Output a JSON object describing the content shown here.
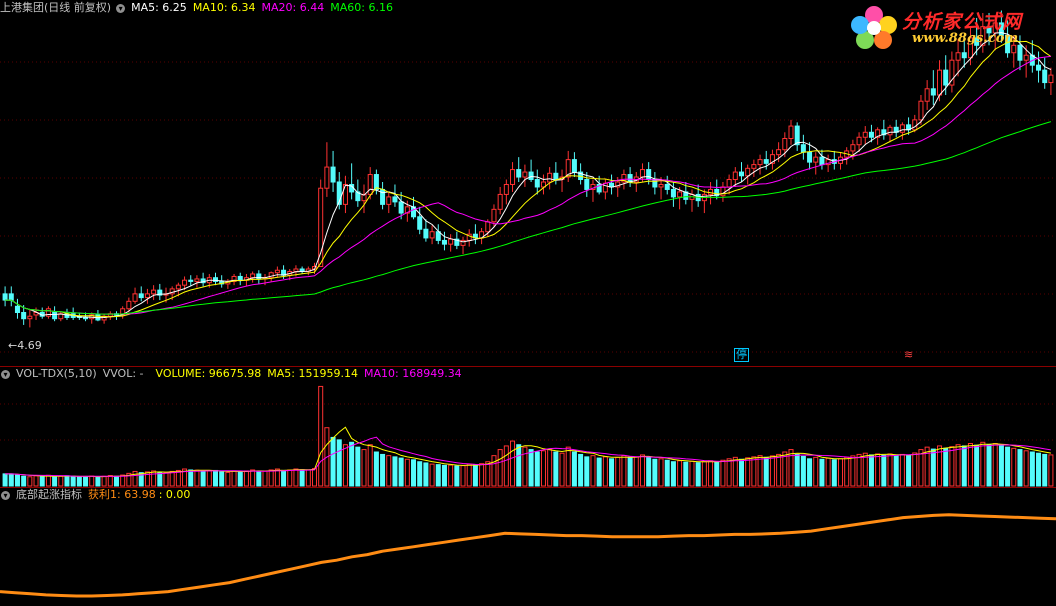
{
  "colors": {
    "up": "#ff3232",
    "down": "#54fcfc",
    "ma5": "#ffffff",
    "ma10": "#ffff00",
    "ma20": "#ff00ff",
    "ma60": "#00ff00",
    "profit": "#ff8c14",
    "sep": "#8b0000"
  },
  "main_header": {
    "stock_title": "上港集团(日线 前复权)",
    "ma5": "MA5: 6.25",
    "ma10": "MA10: 6.34",
    "ma20": "MA20: 6.44",
    "ma60": "MA60: 6.16"
  },
  "low_label": "4.69",
  "event_marks": {
    "halt": "停",
    "other": "≋"
  },
  "logo": {
    "title": "分析家公式网",
    "url": "www.88gs.com",
    "icon": "flower-logo-icon"
  },
  "vol_header": {
    "name": "VOL-TDX(5,10)",
    "vvol": "VVOL: -",
    "volume": "VOLUME: 96675.98",
    "ma5": "MA5: 151959.14",
    "ma10": "MA10: 168949.34"
  },
  "ind_header": {
    "name": "底部起涨指标",
    "profit": "获利1: 63.98",
    "extra": ": 0.00"
  },
  "chart_data": {
    "type": "candlestick",
    "price_ylim": [
      4.4,
      7.2
    ],
    "ohlc": [
      [
        4.9,
        4.96,
        4.8,
        4.85
      ],
      [
        4.9,
        4.96,
        4.8,
        4.85
      ],
      [
        4.8,
        4.86,
        4.7,
        4.75
      ],
      [
        4.75,
        4.81,
        4.65,
        4.7
      ],
      [
        4.7,
        4.77,
        4.63,
        4.72
      ],
      [
        4.73,
        4.79,
        4.69,
        4.75
      ],
      [
        4.75,
        4.79,
        4.7,
        4.72
      ],
      [
        4.72,
        4.8,
        4.7,
        4.78
      ],
      [
        4.75,
        4.8,
        4.68,
        4.7
      ],
      [
        4.7,
        4.76,
        4.68,
        4.74
      ],
      [
        4.74,
        4.78,
        4.69,
        4.71
      ],
      [
        4.74,
        4.79,
        4.69,
        4.71
      ],
      [
        4.72,
        4.75,
        4.69,
        4.71
      ],
      [
        4.71,
        4.75,
        4.68,
        4.7
      ],
      [
        4.7,
        4.75,
        4.66,
        4.73
      ],
      [
        4.73,
        4.77,
        4.68,
        4.69
      ],
      [
        4.69,
        4.74,
        4.66,
        4.72
      ],
      [
        4.72,
        4.76,
        4.69,
        4.74
      ],
      [
        4.74,
        4.76,
        4.69,
        4.73
      ],
      [
        4.73,
        4.8,
        4.7,
        4.78
      ],
      [
        4.78,
        4.87,
        4.75,
        4.84
      ],
      [
        4.84,
        4.95,
        4.82,
        4.9
      ],
      [
        4.9,
        4.96,
        4.84,
        4.87
      ],
      [
        4.87,
        4.94,
        4.82,
        4.9
      ],
      [
        4.9,
        4.97,
        4.85,
        4.93
      ],
      [
        4.93,
        4.98,
        4.85,
        4.89
      ],
      [
        4.89,
        4.95,
        4.83,
        4.9
      ],
      [
        4.9,
        4.96,
        4.85,
        4.94
      ],
      [
        4.94,
        4.99,
        4.88,
        4.97
      ],
      [
        4.97,
        5.04,
        4.93,
        5.01
      ],
      [
        5.01,
        5.05,
        4.96,
        5.0
      ],
      [
        5.0,
        5.05,
        4.95,
        5.02
      ],
      [
        5.02,
        5.07,
        4.96,
        4.99
      ],
      [
        4.99,
        5.06,
        4.95,
        5.03
      ],
      [
        5.03,
        5.07,
        4.97,
        5.0
      ],
      [
        5.0,
        5.05,
        4.95,
        4.98
      ],
      [
        4.98,
        5.02,
        4.94,
        5.0
      ],
      [
        5.0,
        5.06,
        4.97,
        5.04
      ],
      [
        5.04,
        5.07,
        4.97,
        5.01
      ],
      [
        5.01,
        5.06,
        4.96,
        5.03
      ],
      [
        5.03,
        5.08,
        4.99,
        5.06
      ],
      [
        5.06,
        5.09,
        4.98,
        5.02
      ],
      [
        5.02,
        5.06,
        4.97,
        5.03
      ],
      [
        5.03,
        5.08,
        5.0,
        5.07
      ],
      [
        5.07,
        5.12,
        5.03,
        5.09
      ],
      [
        5.09,
        5.13,
        5.02,
        5.05
      ],
      [
        5.05,
        5.1,
        5.01,
        5.08
      ],
      [
        5.08,
        5.13,
        5.04,
        5.1
      ],
      [
        5.1,
        5.12,
        5.06,
        5.08
      ],
      [
        5.08,
        5.12,
        5.05,
        5.1
      ],
      [
        5.1,
        5.15,
        5.06,
        5.12
      ],
      [
        5.12,
        5.82,
        5.12,
        5.75
      ],
      [
        5.75,
        6.12,
        5.68,
        5.92
      ],
      [
        5.92,
        6.05,
        5.72,
        5.8
      ],
      [
        5.8,
        5.88,
        5.58,
        5.62
      ],
      [
        5.62,
        5.85,
        5.55,
        5.78
      ],
      [
        5.78,
        5.95,
        5.66,
        5.72
      ],
      [
        5.72,
        5.82,
        5.6,
        5.65
      ],
      [
        5.65,
        5.78,
        5.55,
        5.7
      ],
      [
        5.7,
        5.92,
        5.66,
        5.86
      ],
      [
        5.86,
        5.9,
        5.7,
        5.74
      ],
      [
        5.74,
        5.8,
        5.58,
        5.62
      ],
      [
        5.62,
        5.72,
        5.55,
        5.68
      ],
      [
        5.68,
        5.78,
        5.6,
        5.64
      ],
      [
        5.64,
        5.72,
        5.5,
        5.55
      ],
      [
        5.55,
        5.65,
        5.48,
        5.6
      ],
      [
        5.6,
        5.68,
        5.5,
        5.52
      ],
      [
        5.52,
        5.6,
        5.38,
        5.42
      ],
      [
        5.42,
        5.5,
        5.32,
        5.35
      ],
      [
        5.35,
        5.45,
        5.3,
        5.4
      ],
      [
        5.4,
        5.46,
        5.3,
        5.33
      ],
      [
        5.33,
        5.4,
        5.25,
        5.3
      ],
      [
        5.3,
        5.38,
        5.24,
        5.34
      ],
      [
        5.34,
        5.4,
        5.26,
        5.29
      ],
      [
        5.29,
        5.36,
        5.22,
        5.33
      ],
      [
        5.33,
        5.42,
        5.28,
        5.38
      ],
      [
        5.38,
        5.46,
        5.3,
        5.35
      ],
      [
        5.35,
        5.43,
        5.3,
        5.4
      ],
      [
        5.4,
        5.5,
        5.36,
        5.48
      ],
      [
        5.48,
        5.62,
        5.44,
        5.58
      ],
      [
        5.58,
        5.76,
        5.54,
        5.7
      ],
      [
        5.7,
        5.82,
        5.62,
        5.78
      ],
      [
        5.78,
        5.96,
        5.72,
        5.9
      ],
      [
        5.9,
        6.0,
        5.8,
        5.84
      ],
      [
        5.84,
        5.94,
        5.76,
        5.88
      ],
      [
        5.88,
        5.98,
        5.8,
        5.82
      ],
      [
        5.82,
        5.9,
        5.7,
        5.76
      ],
      [
        5.76,
        5.86,
        5.7,
        5.8
      ],
      [
        5.8,
        5.92,
        5.74,
        5.87
      ],
      [
        5.87,
        5.96,
        5.78,
        5.82
      ],
      [
        5.82,
        5.9,
        5.72,
        5.84
      ],
      [
        5.84,
        6.05,
        5.8,
        5.98
      ],
      [
        5.98,
        6.04,
        5.84,
        5.88
      ],
      [
        5.88,
        5.95,
        5.78,
        5.82
      ],
      [
        5.82,
        5.88,
        5.68,
        5.74
      ],
      [
        5.74,
        5.82,
        5.64,
        5.78
      ],
      [
        5.78,
        5.85,
        5.7,
        5.72
      ],
      [
        5.72,
        5.82,
        5.66,
        5.79
      ],
      [
        5.79,
        5.86,
        5.7,
        5.76
      ],
      [
        5.76,
        5.84,
        5.68,
        5.8
      ],
      [
        5.8,
        5.9,
        5.74,
        5.86
      ],
      [
        5.86,
        5.92,
        5.76,
        5.8
      ],
      [
        5.8,
        5.88,
        5.72,
        5.84
      ],
      [
        5.84,
        5.95,
        5.8,
        5.9
      ],
      [
        5.9,
        5.96,
        5.78,
        5.82
      ],
      [
        5.82,
        5.88,
        5.7,
        5.76
      ],
      [
        5.76,
        5.84,
        5.66,
        5.78
      ],
      [
        5.78,
        5.85,
        5.7,
        5.74
      ],
      [
        5.74,
        5.8,
        5.6,
        5.68
      ],
      [
        5.68,
        5.76,
        5.58,
        5.72
      ],
      [
        5.72,
        5.8,
        5.62,
        5.66
      ],
      [
        5.66,
        5.74,
        5.56,
        5.7
      ],
      [
        5.7,
        5.78,
        5.6,
        5.65
      ],
      [
        5.65,
        5.74,
        5.55,
        5.7
      ],
      [
        5.7,
        5.8,
        5.62,
        5.74
      ],
      [
        5.74,
        5.82,
        5.66,
        5.69
      ],
      [
        5.69,
        5.8,
        5.64,
        5.76
      ],
      [
        5.76,
        5.86,
        5.7,
        5.82
      ],
      [
        5.82,
        5.92,
        5.76,
        5.88
      ],
      [
        5.88,
        5.96,
        5.8,
        5.85
      ],
      [
        5.85,
        5.94,
        5.78,
        5.91
      ],
      [
        5.91,
        5.98,
        5.84,
        5.94
      ],
      [
        5.94,
        6.02,
        5.86,
        5.98
      ],
      [
        5.98,
        6.05,
        5.9,
        5.95
      ],
      [
        5.95,
        6.06,
        5.9,
        6.02
      ],
      [
        6.02,
        6.12,
        5.96,
        6.06
      ],
      [
        6.06,
        6.2,
        6.0,
        6.15
      ],
      [
        6.15,
        6.3,
        6.1,
        6.25
      ],
      [
        6.25,
        6.28,
        6.05,
        6.1
      ],
      [
        6.1,
        6.18,
        5.98,
        6.04
      ],
      [
        6.04,
        6.12,
        5.9,
        5.96
      ],
      [
        5.96,
        6.04,
        5.86,
        6.0
      ],
      [
        6.0,
        6.06,
        5.9,
        5.94
      ],
      [
        5.94,
        6.02,
        5.88,
        5.98
      ],
      [
        5.98,
        6.05,
        5.9,
        5.95
      ],
      [
        5.95,
        6.04,
        5.9,
        6.0
      ],
      [
        6.0,
        6.08,
        5.94,
        6.05
      ],
      [
        6.05,
        6.14,
        5.98,
        6.1
      ],
      [
        6.1,
        6.2,
        6.04,
        6.16
      ],
      [
        6.16,
        6.25,
        6.1,
        6.2
      ],
      [
        6.2,
        6.26,
        6.12,
        6.16
      ],
      [
        6.16,
        6.24,
        6.1,
        6.22
      ],
      [
        6.22,
        6.3,
        6.14,
        6.18
      ],
      [
        6.18,
        6.26,
        6.12,
        6.24
      ],
      [
        6.24,
        6.3,
        6.16,
        6.2
      ],
      [
        6.2,
        6.28,
        6.14,
        6.26
      ],
      [
        6.26,
        6.32,
        6.18,
        6.22
      ],
      [
        6.22,
        6.34,
        6.2,
        6.3
      ],
      [
        6.3,
        6.5,
        6.26,
        6.45
      ],
      [
        6.45,
        6.62,
        6.38,
        6.55
      ],
      [
        6.55,
        6.7,
        6.42,
        6.5
      ],
      [
        6.5,
        6.78,
        6.45,
        6.7
      ],
      [
        6.7,
        6.82,
        6.5,
        6.58
      ],
      [
        6.58,
        6.85,
        6.52,
        6.78
      ],
      [
        6.78,
        6.95,
        6.65,
        6.84
      ],
      [
        6.84,
        6.98,
        6.72,
        6.8
      ],
      [
        6.8,
        7.05,
        6.74,
        6.96
      ],
      [
        6.96,
        7.12,
        6.82,
        6.9
      ],
      [
        6.9,
        7.16,
        6.84,
        7.05
      ],
      [
        7.05,
        7.16,
        6.9,
        7.0
      ],
      [
        7.0,
        7.14,
        6.86,
        7.08
      ],
      [
        7.08,
        7.18,
        6.92,
        6.98
      ],
      [
        6.98,
        7.1,
        6.8,
        6.84
      ],
      [
        6.84,
        6.98,
        6.72,
        6.9
      ],
      [
        6.9,
        6.98,
        6.7,
        6.78
      ],
      [
        6.78,
        6.9,
        6.64,
        6.82
      ],
      [
        6.82,
        6.94,
        6.68,
        6.74
      ],
      [
        6.74,
        6.85,
        6.6,
        6.7
      ],
      [
        6.7,
        6.8,
        6.55,
        6.6
      ],
      [
        6.6,
        6.72,
        6.5,
        6.66
      ]
    ],
    "volume": [
      50,
      50,
      45,
      40,
      38,
      42,
      40,
      44,
      38,
      40,
      42,
      40,
      38,
      37,
      41,
      38,
      40,
      43,
      40,
      45,
      52,
      60,
      55,
      58,
      62,
      56,
      55,
      60,
      64,
      70,
      66,
      65,
      60,
      62,
      64,
      58,
      56,
      62,
      60,
      62,
      66,
      60,
      61,
      66,
      70,
      64,
      66,
      70,
      67,
      66,
      72,
      410,
      240,
      200,
      190,
      170,
      180,
      160,
      150,
      170,
      140,
      130,
      125,
      120,
      115,
      110,
      108,
      100,
      95,
      90,
      88,
      85,
      86,
      82,
      84,
      90,
      88,
      92,
      100,
      125,
      150,
      165,
      185,
      170,
      160,
      150,
      140,
      145,
      150,
      140,
      135,
      160,
      140,
      130,
      120,
      125,
      115,
      120,
      112,
      118,
      125,
      118,
      120,
      128,
      118,
      110,
      112,
      106,
      100,
      104,
      98,
      102,
      96,
      100,
      104,
      98,
      106,
      112,
      118,
      110,
      116,
      120,
      125,
      118,
      124,
      130,
      140,
      150,
      130,
      122,
      112,
      118,
      110,
      114,
      108,
      112,
      118,
      124,
      130,
      135,
      128,
      132,
      126,
      132,
      124,
      130,
      126,
      136,
      150,
      160,
      152,
      165,
      155,
      162,
      170,
      165,
      175,
      168,
      180,
      170,
      175,
      168,
      160,
      155,
      150,
      145,
      140,
      135,
      130,
      128
    ],
    "vol_ylim": [
      0,
      420
    ],
    "profit": [
      12,
      11,
      10,
      9,
      8.5,
      8,
      8,
      8.5,
      9,
      10,
      11,
      12,
      14,
      16,
      18,
      20,
      23,
      26,
      29,
      32,
      35,
      38,
      40,
      43,
      45,
      48,
      50,
      52,
      54,
      56,
      58,
      60,
      62,
      64,
      63.5,
      63,
      62.5,
      62,
      62,
      61.5,
      61,
      61,
      61,
      61,
      61.5,
      62,
      62,
      62.5,
      63,
      63,
      63.5,
      64,
      65,
      66,
      68,
      70,
      72,
      74,
      76,
      78,
      79,
      80,
      80.5,
      80,
      79.5,
      79,
      78.5,
      78,
      77.5,
      77
    ],
    "profit_ylim": [
      0,
      100
    ]
  }
}
